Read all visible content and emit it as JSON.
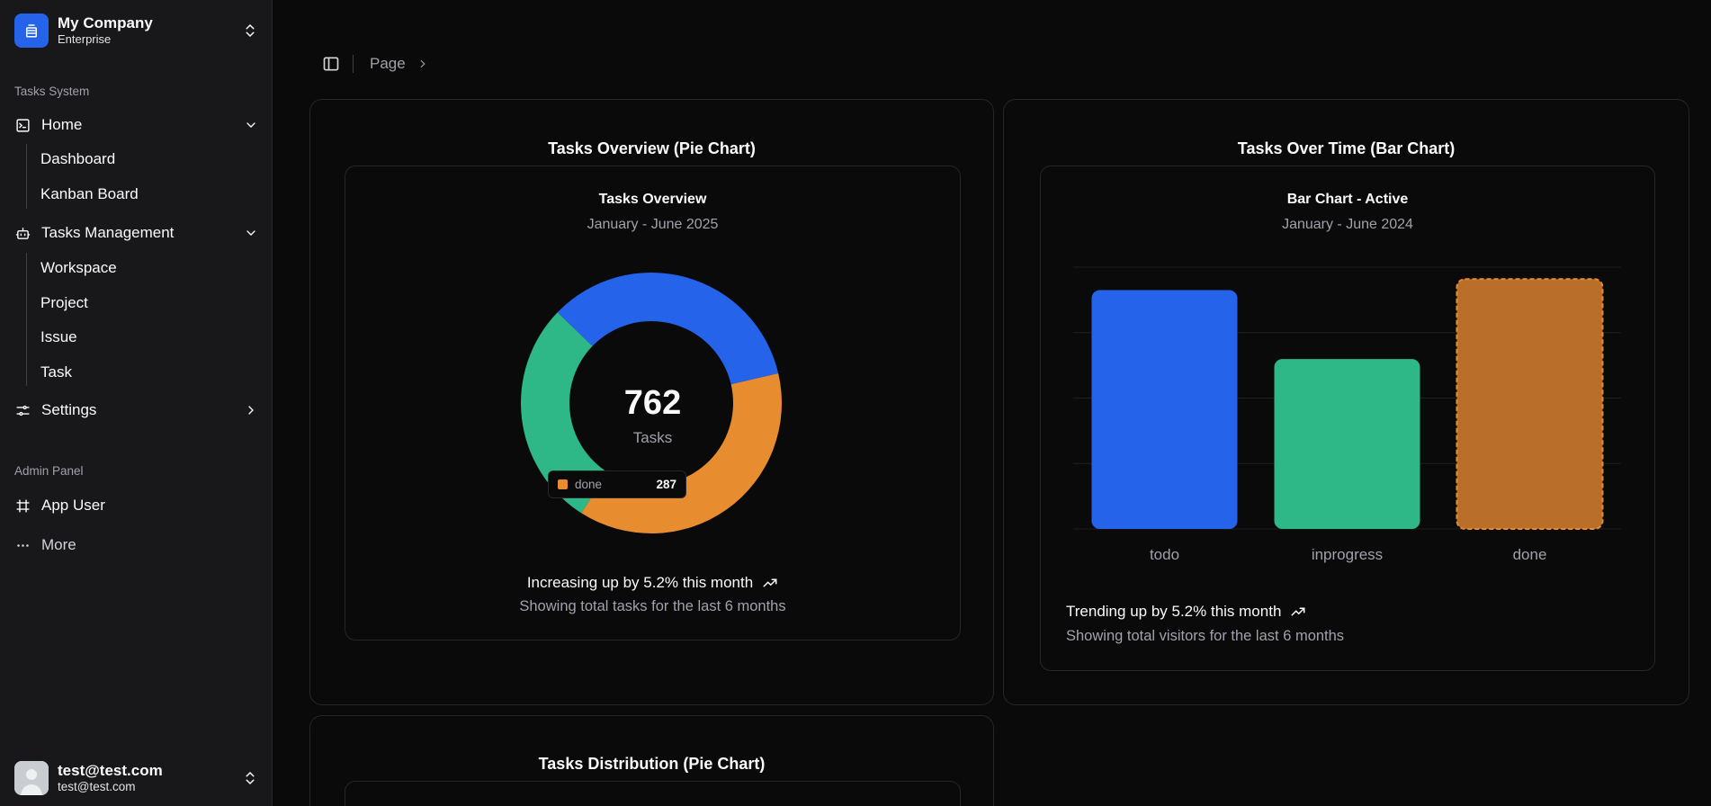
{
  "colors": {
    "blue": "#2563eb",
    "green": "#2eb887",
    "orange": "#e88c30",
    "orange_active": "#b96e2a"
  },
  "company": {
    "name": "My Company",
    "plan": "Enterprise",
    "icon": "building-icon"
  },
  "sidebar": {
    "group1_label": "Tasks System",
    "home": {
      "label": "Home",
      "icon": "home-terminal-icon",
      "children": [
        "Dashboard",
        "Kanban Board"
      ]
    },
    "tasks_mgmt": {
      "label": "Tasks Management",
      "icon": "bot-icon",
      "children": [
        "Workspace",
        "Project",
        "Issue",
        "Task"
      ]
    },
    "settings": {
      "label": "Settings",
      "icon": "settings-sliders-icon"
    },
    "group2_label": "Admin Panel",
    "app_user": {
      "label": "App User",
      "icon": "hash-frame-icon"
    },
    "more": {
      "label": "More",
      "icon": "ellipsis-icon"
    }
  },
  "user": {
    "name": "test@test.com",
    "email": "test@test.com"
  },
  "breadcrumb": {
    "page": "Page"
  },
  "pie_card": {
    "title": "Tasks Overview (Pie Chart)",
    "inner_title": "Tasks Overview",
    "inner_sub": "January - June 2025",
    "total": "762",
    "total_label": "Tasks",
    "tooltip": {
      "label": "done",
      "value": "287"
    },
    "footer_main": "Increasing up by 5.2% this month",
    "footer_sub": "Showing total tasks for the last 6 months"
  },
  "bar_card": {
    "title": "Tasks Over Time (Bar Chart)",
    "inner_title": "Bar Chart - Active",
    "inner_sub": "January - June 2024",
    "footer_main": "Trending up by 5.2% this month",
    "footer_sub": "Showing total visitors for the last 6 months"
  },
  "dist_card": {
    "title": "Tasks Distribution (Pie Chart)"
  },
  "chart_data": [
    {
      "type": "pie",
      "title": "Tasks Overview",
      "subtitle": "January - June 2025",
      "categories": [
        "todo",
        "inprogress",
        "done"
      ],
      "values": [
        260,
        215,
        287
      ],
      "colors": [
        "#2563eb",
        "#2eb887",
        "#e88c30"
      ],
      "total": 762
    },
    {
      "type": "bar",
      "title": "Bar Chart - Active",
      "subtitle": "January - June 2024",
      "categories": [
        "todo",
        "inprogress",
        "done"
      ],
      "values": [
        260,
        185,
        272
      ],
      "colors": [
        "#2563eb",
        "#2eb887",
        "#b96e2a"
      ],
      "active": "done",
      "ylim": [
        0,
        285
      ],
      "grid": true
    }
  ]
}
